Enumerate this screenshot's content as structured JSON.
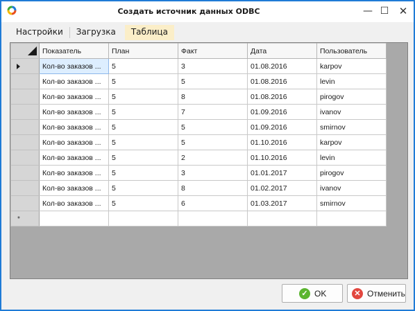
{
  "window": {
    "title": "Создать источник данных ODBC",
    "minimize": "—",
    "maximize": "☐",
    "close": "✕"
  },
  "tabs": [
    {
      "label": "Настройки"
    },
    {
      "label": "Загрузка"
    },
    {
      "label": "Таблица",
      "active": true
    }
  ],
  "grid": {
    "columns": [
      "Показатель",
      "План",
      "Факт",
      "Дата",
      "Пользователь"
    ],
    "rows": [
      [
        "Кол-во заказов ...",
        "5",
        "3",
        "01.08.2016",
        "karpov"
      ],
      [
        "Кол-во заказов ...",
        "5",
        "5",
        "01.08.2016",
        "levin"
      ],
      [
        "Кол-во заказов ...",
        "5",
        "8",
        "01.08.2016",
        "pirogov"
      ],
      [
        "Кол-во заказов ...",
        "5",
        "7",
        "01.09.2016",
        "ivanov"
      ],
      [
        "Кол-во заказов ...",
        "5",
        "5",
        "01.09.2016",
        "smirnov"
      ],
      [
        "Кол-во заказов ...",
        "5",
        "5",
        "01.10.2016",
        "karpov"
      ],
      [
        "Кол-во заказов ...",
        "5",
        "2",
        "01.10.2016",
        "levin"
      ],
      [
        "Кол-во заказов ...",
        "5",
        "3",
        "01.01.2017",
        "pirogov"
      ],
      [
        "Кол-во заказов ...",
        "5",
        "8",
        "01.02.2017",
        "ivanov"
      ],
      [
        "Кол-во заказов ...",
        "5",
        "6",
        "01.03.2017",
        "smirnov"
      ]
    ],
    "new_row_marker": "*"
  },
  "buttons": {
    "ok": "OK",
    "ok_icon": "✓",
    "cancel": "Отменить",
    "cancel_icon": "✕"
  },
  "colors": {
    "window_border": "#1f7bd6",
    "active_tab": "#fbeec8",
    "grid_background": "#a9a9a9",
    "ok_icon": "#5bb530",
    "cancel_icon": "#e2473f"
  },
  "icons": {
    "app": "app-logo-icon",
    "current_row": "row-pointer-icon",
    "corner": "select-all-icon"
  }
}
